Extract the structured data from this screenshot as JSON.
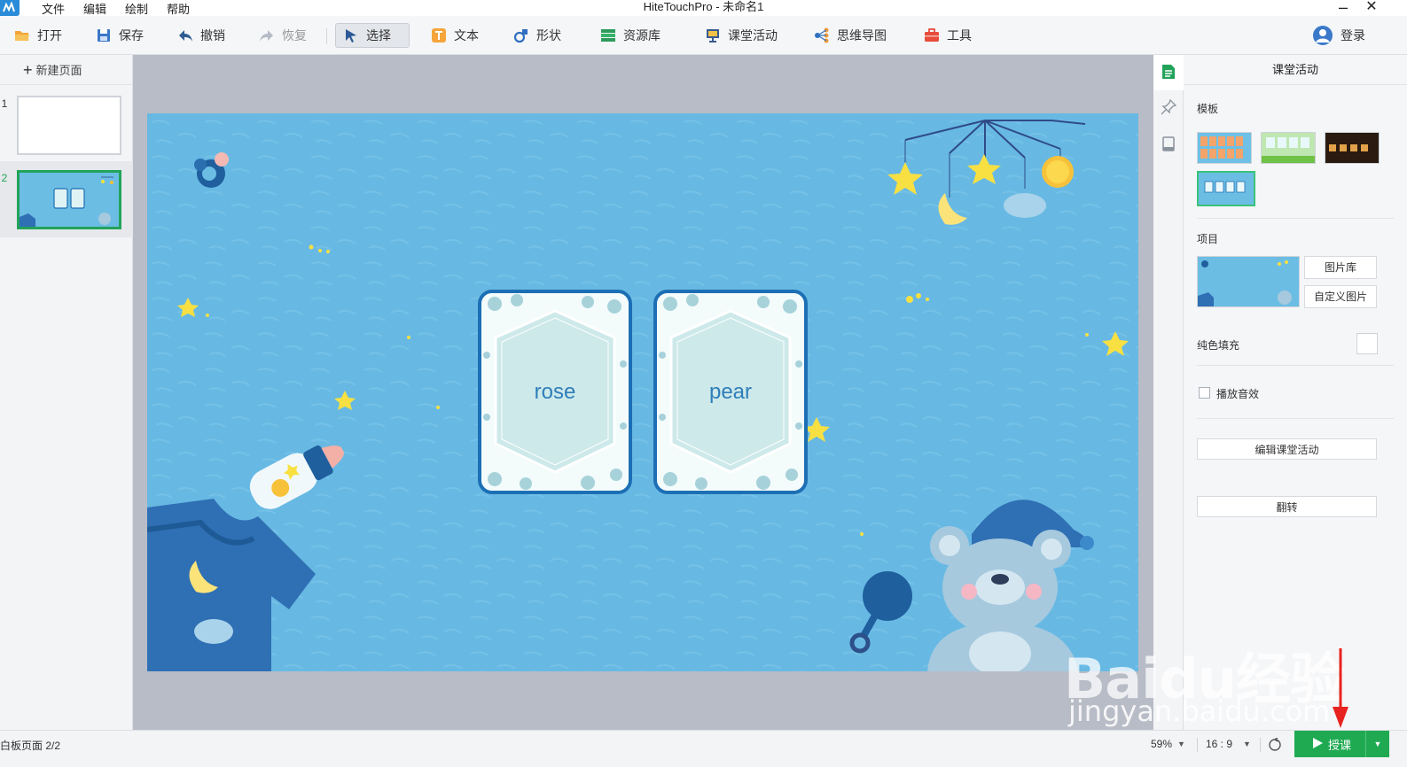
{
  "window": {
    "title": "HiteTouchPro - 未命名1",
    "menu": [
      "文件",
      "编辑",
      "绘制",
      "帮助"
    ],
    "close_glyph": "✕"
  },
  "toolbar": {
    "open": "打开",
    "save": "保存",
    "undo": "撤销",
    "redo": "恢复",
    "select": "选择",
    "text": "文本",
    "shape": "形状",
    "resources": "资源库",
    "classroom_activity": "课堂活动",
    "mind_map": "思维导图",
    "tools": "工具",
    "login": "登录"
  },
  "pages_panel": {
    "new_page": "新建页面",
    "pages": [
      {
        "number": "1",
        "selected": false
      },
      {
        "number": "2",
        "selected": true
      }
    ]
  },
  "slide": {
    "background_color": "#67b9e3",
    "cards": [
      {
        "word": "rose"
      },
      {
        "word": "pear"
      }
    ]
  },
  "side_tabs": [
    "document-icon",
    "pin-icon",
    "book-icon"
  ],
  "right_panel": {
    "title": "课堂活动",
    "template_label": "模板",
    "templates": [
      {
        "name": "template-orange-grid",
        "color": "#f4a46a"
      },
      {
        "name": "template-green-cards",
        "color": "#8fd36d"
      },
      {
        "name": "template-dark-film",
        "color": "#3b2415"
      },
      {
        "name": "template-blue-baby",
        "color": "#6cbde4",
        "selected": true
      }
    ],
    "item_label": "项目",
    "image_library": "图片库",
    "custom_image": "自定义图片",
    "solid_fill_label": "纯色填充",
    "play_sound_label": "播放音效",
    "edit_activity": "编辑课堂活动",
    "flip": "翻转"
  },
  "statusbar": {
    "page_info": "白板页面 2/2",
    "zoom": "59%",
    "aspect": "16 : 9",
    "present": "授课"
  },
  "watermark": {
    "brand": "Baidu经验",
    "url": "jingyan.baidu.com"
  },
  "colors": {
    "accent_green": "#1faa52",
    "card_border": "#1c6fb4",
    "slide_blue": "#67b9e3"
  }
}
